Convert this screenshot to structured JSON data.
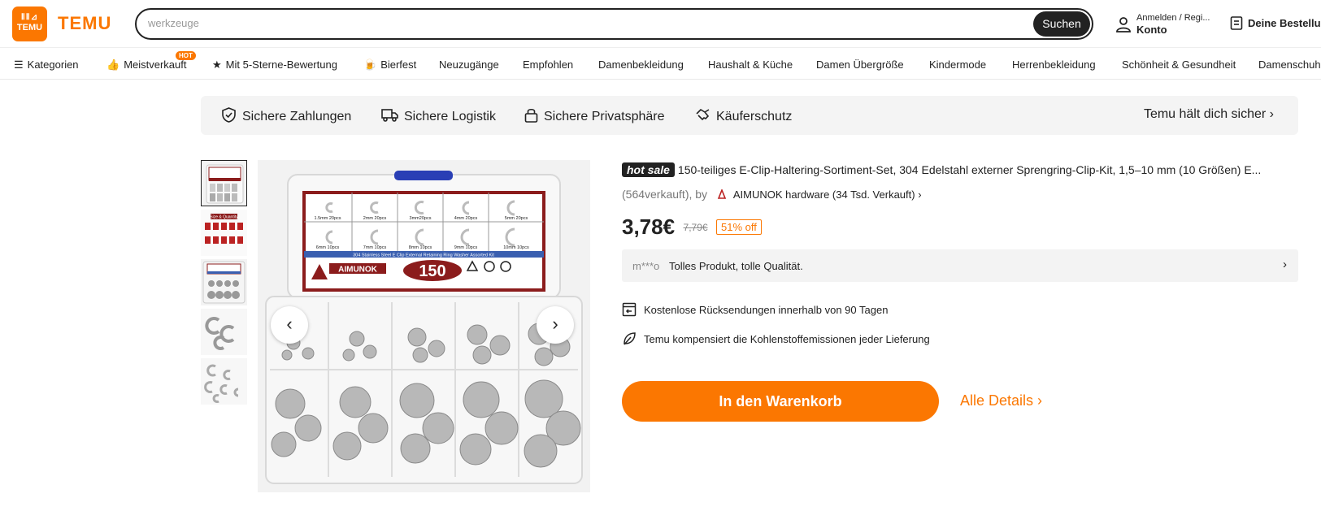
{
  "header": {
    "logo_top": "ⅡⅡ⊿",
    "logo_text": "TEMU",
    "brand": "TEMU",
    "search_value": "werkzeuge",
    "search_button": "Suchen",
    "account_top": "Anmelden / Regi...",
    "account_bottom": "Konto",
    "orders": "Deine Bestellung"
  },
  "nav": {
    "categories": "Kategorien",
    "items": [
      "Meistverkauft",
      "Mit 5-Sterne-Bewertung",
      "Bierfest",
      "Neuzugänge",
      "Empfohlen",
      "Damenbekleidung",
      "Haushalt & Küche",
      "Damen Übergröße",
      "Kindermode",
      "Herrenbekleidung",
      "Schönheit & Gesundheit",
      "Damenschuhe"
    ],
    "hot_badge": "HOT"
  },
  "trust": {
    "items": [
      "Sichere Zahlungen",
      "Sichere Logistik",
      "Sichere Privatsphäre",
      "Käuferschutz"
    ],
    "right": "Temu hält dich sicher ›"
  },
  "gallery": {
    "prev": "‹",
    "next": "›",
    "product_box_label": "AIMUNOK",
    "product_count": "150",
    "product_strip": "304 Stainless Steel E Clip External Retaining Ring Washer Assorted Kit",
    "sizes": [
      "1.5mm 20pcs",
      "2mm 20pcs",
      "3mm20pcs",
      "4mm 20pcs",
      "5mm 20pcs",
      "6mm 10pcs",
      "7mm 10pcs",
      "8mm 10pcs",
      "9mm 10pcs",
      "10mm 10pcs"
    ],
    "thumb2_label": "Size & Quantity"
  },
  "product": {
    "hot_sale": "hot sale",
    "title": "150-teiliges E-Clip-Haltering-Sortiment-Set, 304 Edelstahl externer Sprengring-Clip-Kit, 1,5–10 mm (10 Größen) E...",
    "sold": "(564verkauft), by",
    "shop": "AIMUNOK hardware (34 Tsd. Verkauft) ›",
    "price": "3,78€",
    "old_price": "7,79€",
    "discount": "51% off",
    "review_user": "m***o",
    "review_text": "Tolles Produkt, tolle Qualität.",
    "review_arrow": "›",
    "feature_returns": "Kostenlose Rücksendungen innerhalb von 90 Tagen",
    "feature_carbon": "Temu kompensiert die Kohlenstoffemissionen jeder Lieferung",
    "cart_button": "In den Warenkorb",
    "all_details": "Alle Details ›"
  },
  "colors": {
    "accent": "#fb7701",
    "dark": "#222222",
    "panel": "#f4f4f4"
  }
}
